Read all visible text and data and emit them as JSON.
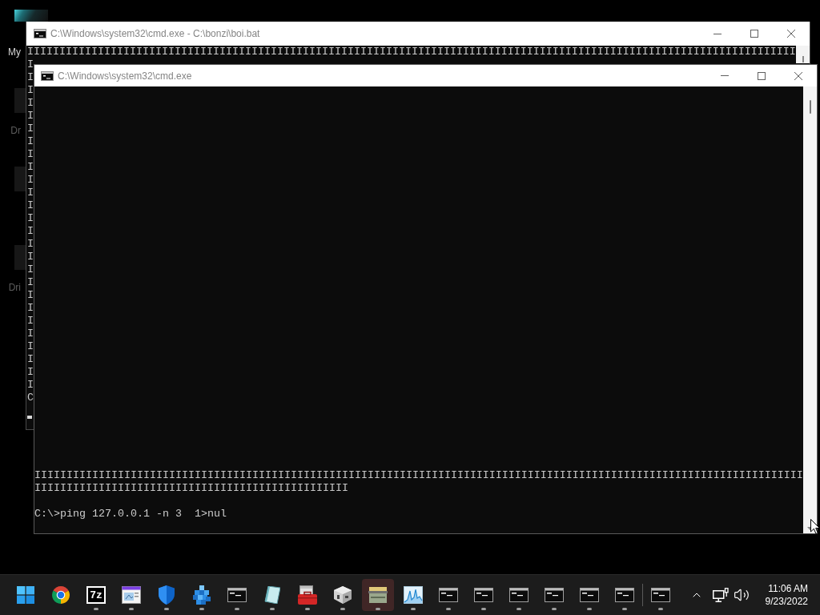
{
  "desktop": {
    "icons": [
      {
        "kind": "teal",
        "label": "My",
        "dimmed": false
      },
      {
        "kind": "dark",
        "label": "Dr",
        "dimmed": true
      },
      {
        "kind": "dark"
      },
      {
        "kind": "dark",
        "label": "Dri",
        "dimmed": true
      }
    ]
  },
  "back_window": {
    "title": "C:\\Windows\\system32\\cmd.exe - C:\\bonzi\\boi.bat",
    "console_lines": [
      "IIIIIIIIIIIIIIIIIIIIIIIIIIIIIIIIIIIIIIIIIIIIIIIIIIIIIIIIIIIIIIIIIIIIIIIIIIIIIIIIIIIIIIIIIIIIIIIIIIIIIIIIIIIIIIIIIIIIIIII",
      "I",
      "I",
      "I",
      "I",
      "I",
      "I",
      "I",
      "I",
      "I",
      "I",
      "I",
      "I",
      "I",
      "I",
      "I",
      "I",
      "I",
      "I",
      "I",
      "I",
      "I",
      "I",
      "I",
      "I",
      "I",
      "I",
      "C"
    ]
  },
  "front_window": {
    "title": "C:\\Windows\\system32\\cmd.exe",
    "output_lines": [
      "IIIIIIIIIIIIIIIIIIIIIIIIIIIIIIIIIIIIIIIIIIIIIIIIIIIIIIIIIIIIIIIIIIIIIIIIIIIIIIIIIIIIIIIIIIIIIIIIIIIIIIIIIIIIIIIIIIIIIIII",
      "IIIIIIIIIIIIIIIIIIIIIIIIIIIIIIIIIIIIIIIIIIIIIIIII"
    ],
    "prompt": "C:\\>ping 127.0.0.1 -n 3  1>nul"
  },
  "taskbar": {
    "items": [
      {
        "kind": "start",
        "running": false,
        "highlighted": false
      },
      {
        "kind": "browser",
        "running": false,
        "highlighted": false
      },
      {
        "kind": "archiver",
        "logo_text": "7z",
        "running": true,
        "highlighted": false
      },
      {
        "kind": "window-app",
        "running": true,
        "highlighted": false
      },
      {
        "kind": "shield",
        "running": true,
        "highlighted": false
      },
      {
        "kind": "cubes",
        "running": true,
        "highlighted": false
      },
      {
        "kind": "console",
        "running": true,
        "highlighted": false
      },
      {
        "kind": "notes",
        "running": true,
        "highlighted": false
      },
      {
        "kind": "toolbox",
        "running": true,
        "highlighted": false
      },
      {
        "kind": "cube",
        "running": true,
        "highlighted": false
      },
      {
        "kind": "scanner",
        "running": true,
        "highlighted": true
      },
      {
        "kind": "chart",
        "running": true,
        "highlighted": false
      },
      {
        "kind": "console",
        "running": true,
        "highlighted": false
      },
      {
        "kind": "console",
        "running": true,
        "highlighted": false
      },
      {
        "kind": "console",
        "running": true,
        "highlighted": false
      },
      {
        "kind": "console",
        "running": true,
        "highlighted": false
      },
      {
        "kind": "console",
        "running": true,
        "highlighted": false
      },
      {
        "kind": "console",
        "running": true,
        "highlighted": false
      },
      {
        "kind": "separator"
      },
      {
        "kind": "console",
        "running": true,
        "highlighted": false
      }
    ],
    "clock": {
      "time": "11:06 AM",
      "date": "9/23/2022"
    }
  }
}
